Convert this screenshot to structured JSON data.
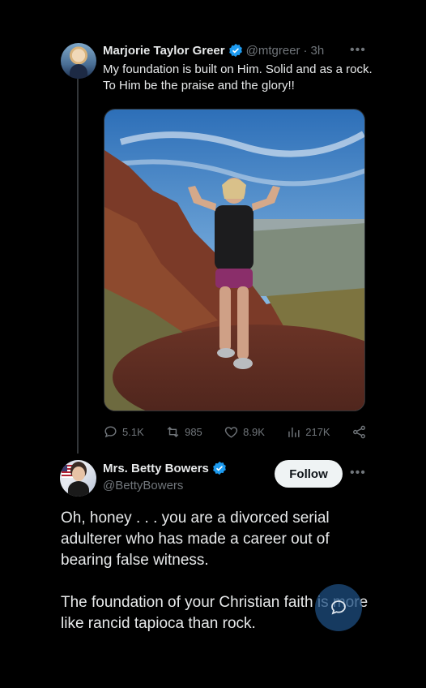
{
  "original_tweet": {
    "display_name": "Marjorie Taylor Greer",
    "handle": "@mtgreer",
    "separator": "·",
    "time": "3h",
    "text": "My foundation is built on Him. Solid and as a rock. To Him be the praise and the glory!!",
    "stats": {
      "replies": "5.1K",
      "retweets": "985",
      "likes": "8.9K",
      "views": "217K"
    }
  },
  "reply": {
    "display_name": "Mrs. Betty Bowers",
    "handle": "@BettyBowers",
    "follow_label": "Follow",
    "paragraphs": [
      "Oh, honey . . . you are a divorced serial adulterer who has made a career out of bearing false witness.",
      "The foundation of your Christian faith is more like rancid tapioca than rock."
    ]
  },
  "icons": {
    "verified": "verified-badge-icon",
    "reply": "reply-icon",
    "retweet": "retweet-icon",
    "like": "heart-icon",
    "views": "analytics-icon",
    "share": "share-icon",
    "more": "more-dots-icon",
    "compose": "compose-reply-icon"
  },
  "colors": {
    "background": "#000000",
    "text_primary": "#e7e9ea",
    "text_secondary": "#71767b",
    "verified_blue": "#1d9bf0",
    "follow_bg": "#eff3f4"
  }
}
